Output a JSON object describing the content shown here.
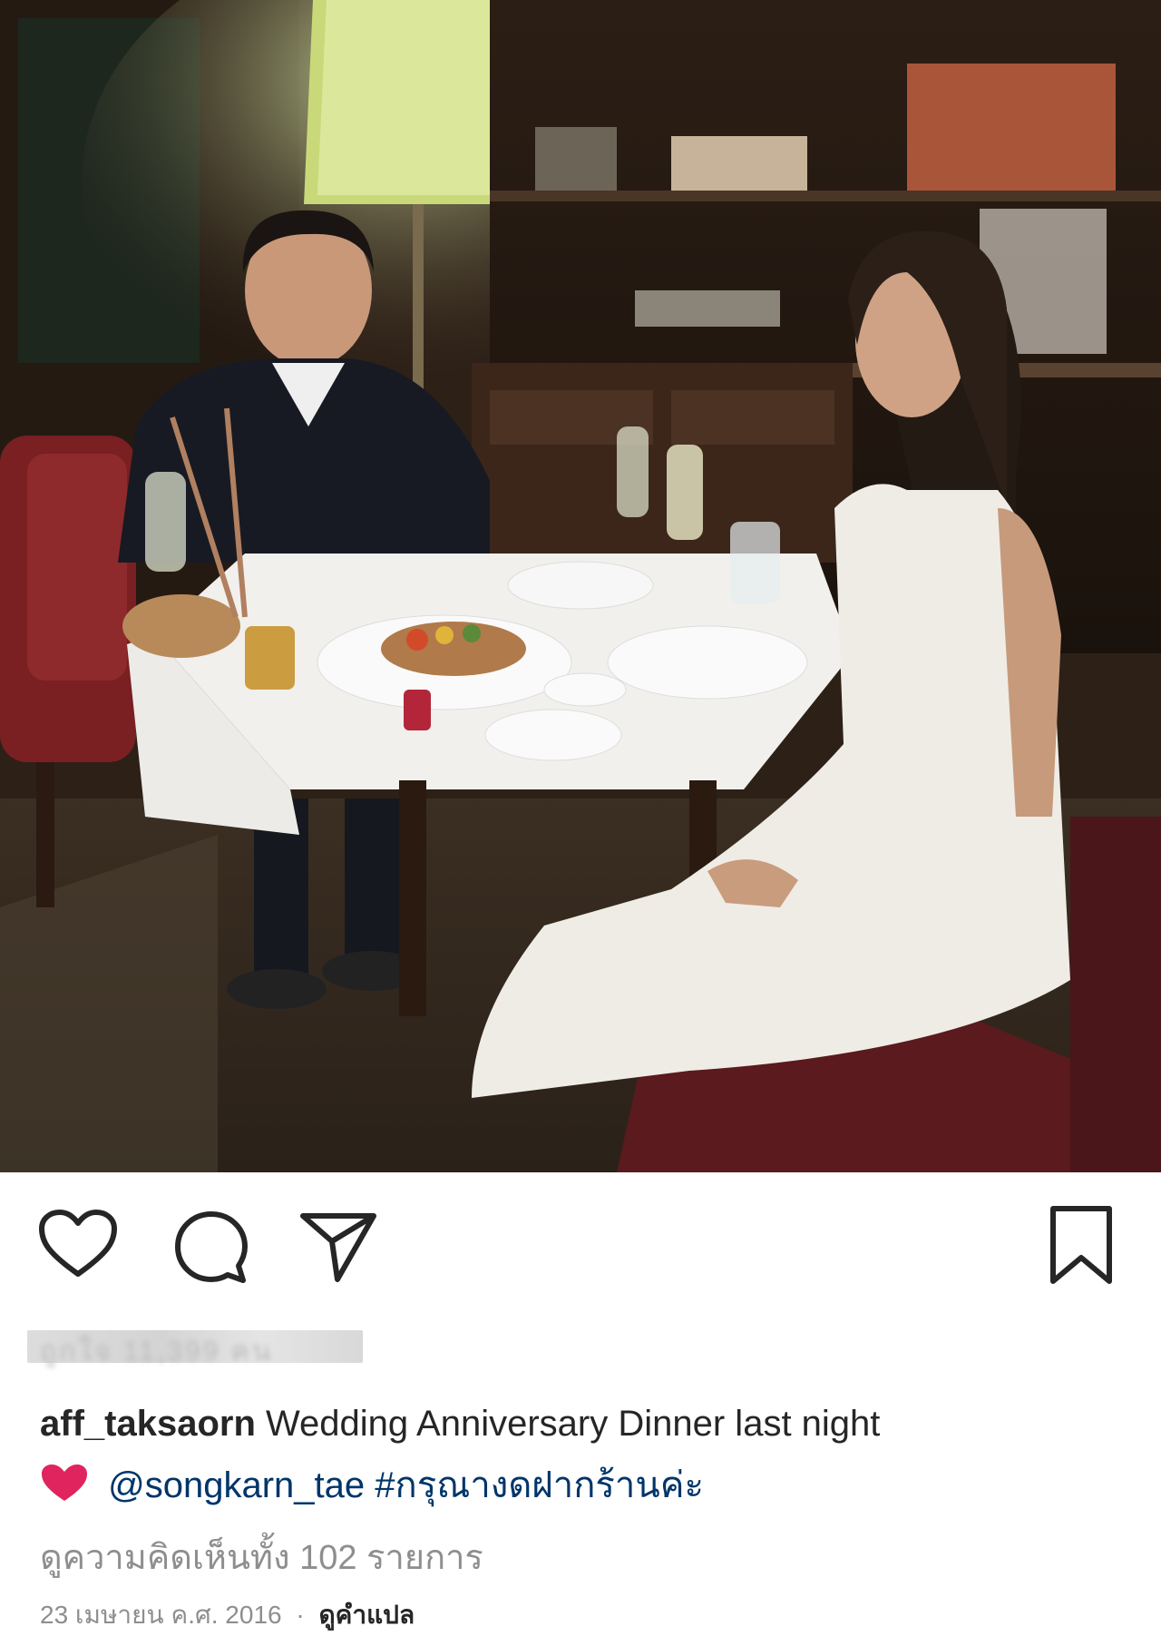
{
  "post": {
    "photo_alt": "photo",
    "actions": {
      "like": "heart-icon",
      "comment": "comment-icon",
      "share": "share-icon",
      "save": "bookmark-icon"
    },
    "likes_text": "ถูกใจ 11,399 คน",
    "caption": {
      "username": "aff_taksaorn",
      "text": "Wedding Anniversary Dinner last night",
      "emoji": "heart-emoji",
      "mention": "@songkarn_tae",
      "hashtag": "#กรุณางดฝากร้านค่ะ"
    },
    "view_comments": "ดูความคิดเห็นทั้ง 102 รายการ",
    "date": "23 เมษายน ค.ศ. 2016",
    "separator": "·",
    "translate": "ดูคำแปล"
  },
  "colors": {
    "text": "#262626",
    "link": "#003569",
    "muted": "#8e8e8e",
    "heart": "#e0245e"
  }
}
